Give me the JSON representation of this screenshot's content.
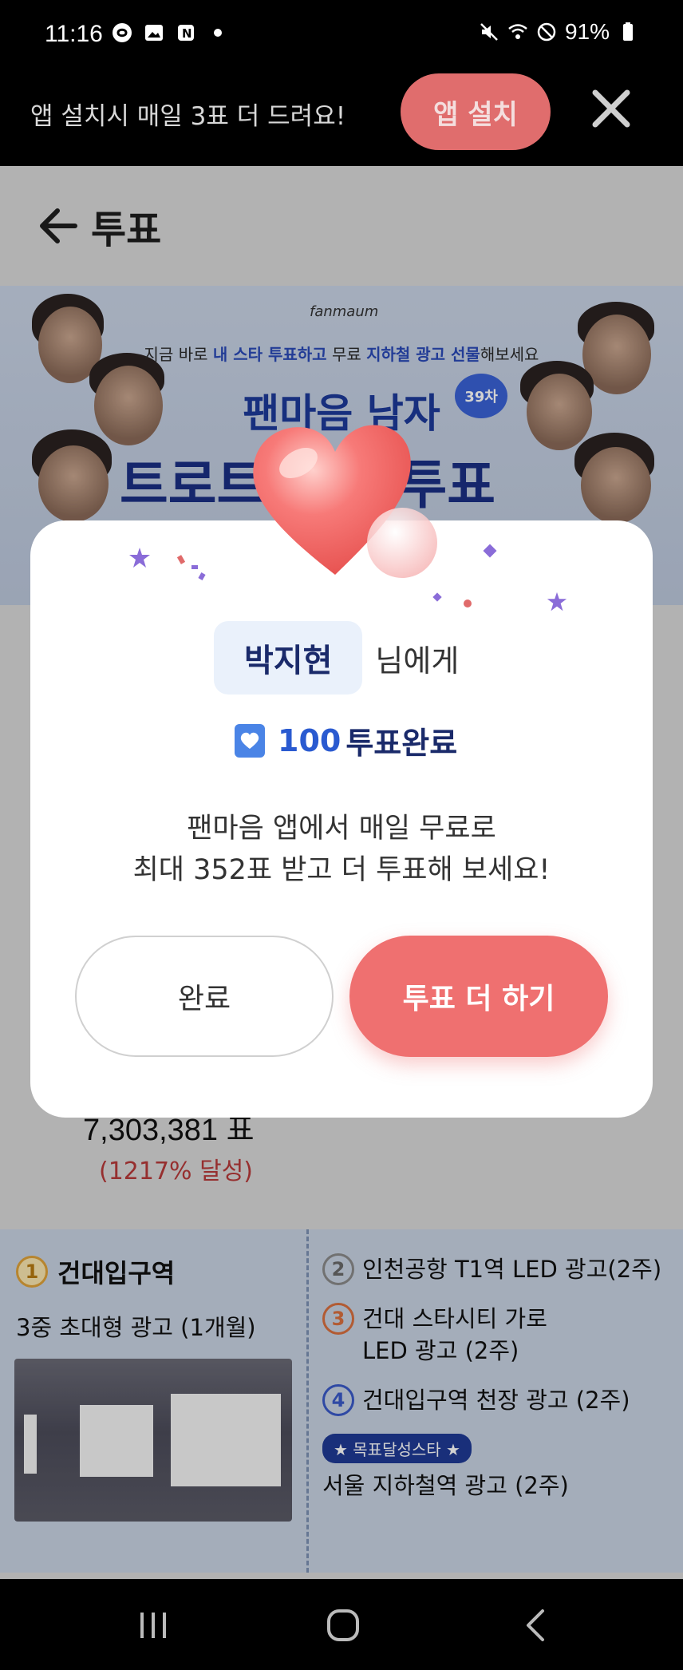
{
  "status_bar": {
    "time": "11:16",
    "battery": "91%",
    "icons": [
      "s-pay-icon",
      "gallery-icon",
      "notification-n-icon",
      "dot-icon",
      "mute-icon",
      "wifi-icon",
      "do-not-disturb-icon",
      "battery-icon"
    ]
  },
  "install_banner": {
    "text": "앱 설치시 매일 3표 더 드려요!",
    "button_label": "앱 설치",
    "close_icon": "close-icon"
  },
  "header": {
    "title": "투표",
    "back_icon": "back-arrow-icon"
  },
  "promo_banner": {
    "logo": "fanmaum",
    "sub_pre": "지금 바로 ",
    "sub_hl1": "내 스타 투표하고",
    "sub_mid": " 무료 ",
    "sub_hl2": "지하철 광고 선물",
    "sub_post": "해보세요",
    "title_line1": "팬마음 남자",
    "title_line2": "트로트 스타 투표",
    "round_badge": "39차"
  },
  "background": {
    "vote_total": "7,303,381 표",
    "vote_percent": "(1217% 달성)",
    "ad_main": {
      "number": "1",
      "title": "건대입구역",
      "subtitle": "3중 초대형 광고 (1개월)"
    },
    "ad_items": [
      {
        "number": "2",
        "text": "인천공항 T1역 LED 광고(2주)",
        "color": "#8a8a8a"
      },
      {
        "number": "3",
        "text": "건대 스타시티 가로\nLED 광고 (2주)",
        "color": "#d9703f"
      },
      {
        "number": "4",
        "text": "건대입구역 천장 광고 (2주)",
        "color": "#3a5ac8"
      }
    ],
    "goal_badge": "★ 목표달성스타 ★",
    "goal_ad": "서울 지하철역 광고 (2주)"
  },
  "dialog": {
    "recipient_name": "박지현",
    "recipient_suffix": "님에게",
    "vote_count": "100",
    "vote_done": "투표완료",
    "message_line1": "팬마음 앱에서 매일 무료로",
    "message_line2": "최대 352표 받고 더 투표해 보세요!",
    "complete_label": "완료",
    "more_label": "투표 더 하기"
  },
  "colors": {
    "accent": "#ef7070",
    "brand_blue": "#2a5ad0",
    "navy": "#1a2a6a"
  },
  "nav_bar": {
    "icons": [
      "recent-apps-icon",
      "home-icon",
      "back-icon"
    ]
  }
}
